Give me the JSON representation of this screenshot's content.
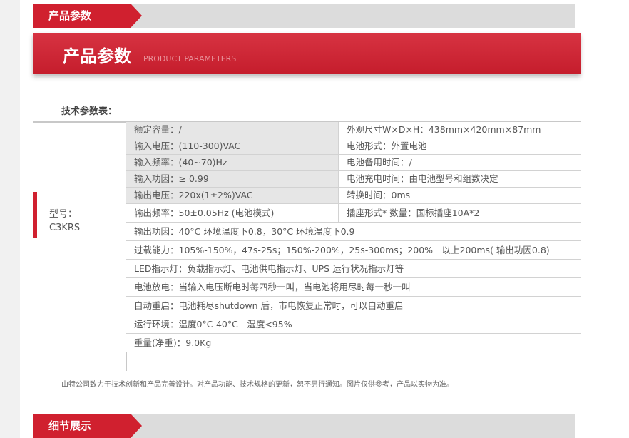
{
  "section1": {
    "tab": "产品参数"
  },
  "banner": {
    "title": "产品参数",
    "subtitle": "PRODUCT PARAMETERS"
  },
  "table": {
    "title": "技术参数表：",
    "model_label": "型号：",
    "model_value": "C3KRS",
    "pair_rows": [
      {
        "left": "额定容量：/",
        "right": "外观尺寸W×D×H：438mm×420mm×87mm"
      },
      {
        "left": "输入电压：(110-300)VAC",
        "right": "电池形式：外置电池"
      },
      {
        "left": "输入频率：(40~70)Hz",
        "right": "电池备用时间：/"
      },
      {
        "left": "输入功因：≥ 0.99",
        "right": "电池充电时间：由电池型号和组数决定"
      },
      {
        "left": "输出电压：220x(1±2%)VAC",
        "right": "转换时间：0ms"
      },
      {
        "left": "输出频率：50±0.05Hz (电池模式)",
        "right": "插座形式* 数量：国标插座10A*2"
      }
    ],
    "full_rows": [
      "输出功因：40°C 环境温度下0.8，30°C 环境温度下0.9",
      "过载能力：105%-150%，47s-25s；150%-200%，25s-300ms；200%　以上200ms( 输出功因0.8)",
      "LED指示灯：负载指示灯、电池供电指示灯、UPS 运行状况指示灯等",
      "电池放电：当输入电压断电时每四秒一叫，当电池将用尽时每一秒一叫",
      "自动重启：电池耗尽shutdown 后，市电恢复正常时，可以自动重启",
      "运行环境：温度0°C-40°C　湿度<95%",
      "重量(净重)：9.0Kg"
    ]
  },
  "note": "山特公司致力于技术创新和产品完善设计。对产品功能、技术规格的更新，恕不另行通知。图片仅供参考，产品以实物为准。",
  "section2": {
    "tab": "细节展示"
  },
  "colors": {
    "accent": "#d0202f",
    "bar_gray": "#dcdcdc"
  }
}
